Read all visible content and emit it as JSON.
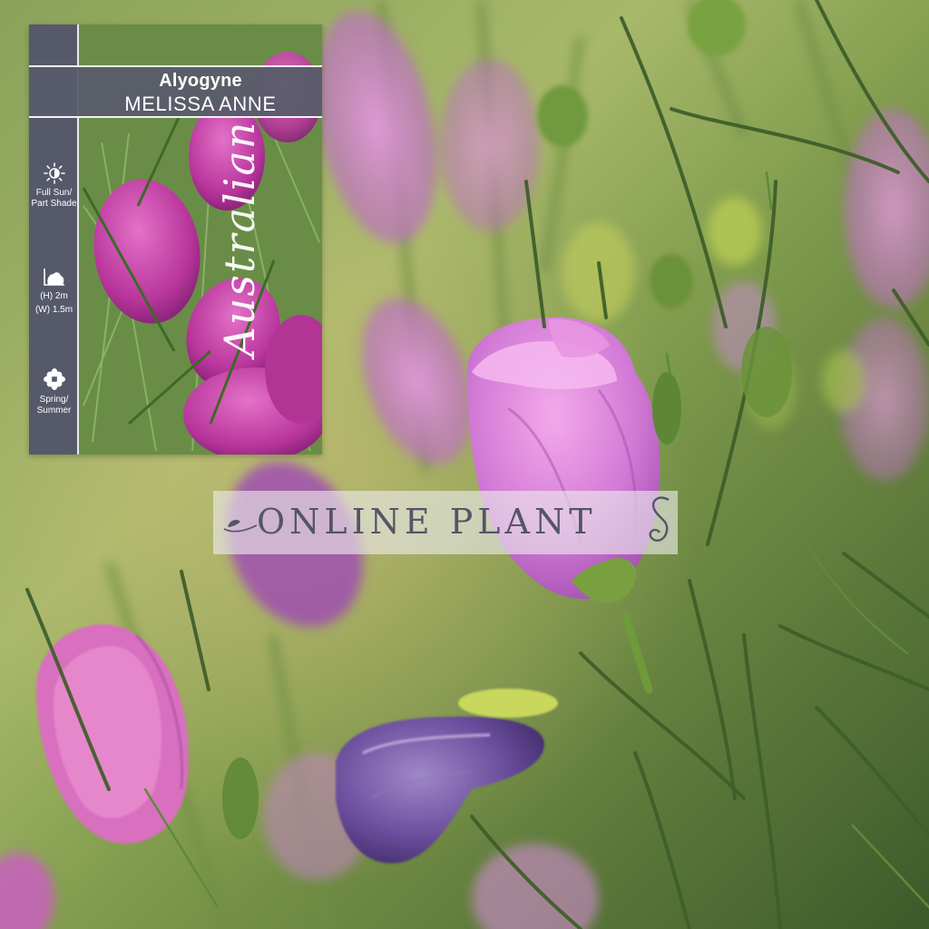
{
  "label": {
    "genus": "Alyogyne",
    "cultivar": "MELISSA ANNE",
    "origin": "Australian",
    "care": {
      "sun": {
        "icon": "sun-icon",
        "text": "Full Sun/ Part Shade"
      },
      "size": {
        "icon": "shrub-size-icon",
        "height": "(H) 2m",
        "width": "(W) 1.5m"
      },
      "season": {
        "icon": "flower-icon",
        "text": "Spring/ Summer"
      }
    }
  },
  "watermark": {
    "text": "ONLINE PLANT",
    "trailing_letter": "S"
  },
  "colors": {
    "strip": "#55596a",
    "text": "#ffffff",
    "petal": "#c05cc6",
    "foliage": "#4f6e35"
  }
}
